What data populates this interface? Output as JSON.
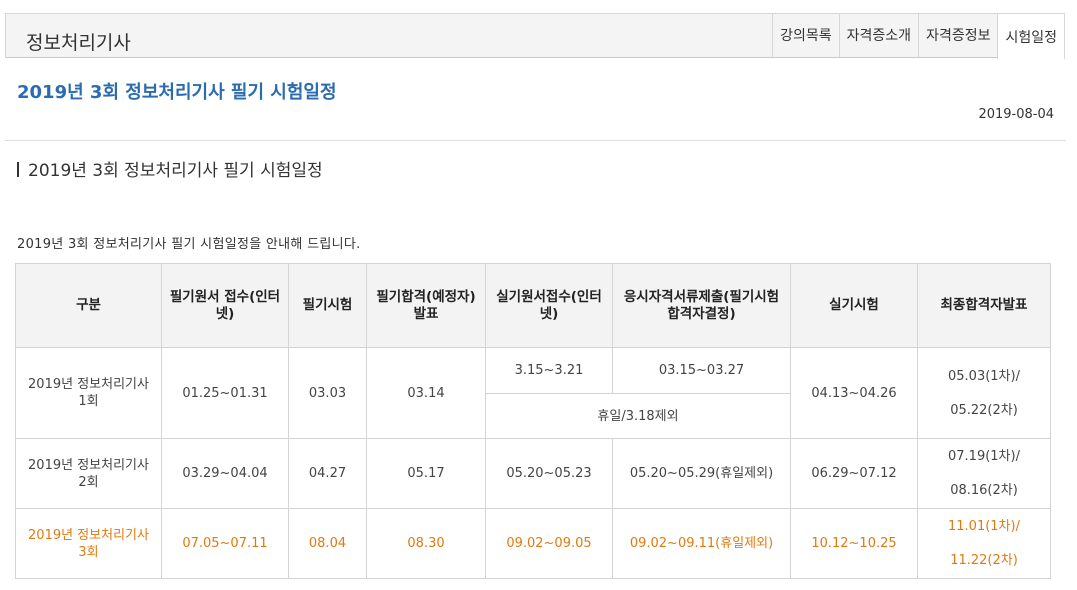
{
  "header": {
    "site_title": "정보처리기사",
    "tabs": [
      {
        "label": "강의목록",
        "active": false
      },
      {
        "label": "자격증소개",
        "active": false
      },
      {
        "label": "자격증정보",
        "active": false
      },
      {
        "label": "시험일정",
        "active": true
      }
    ]
  },
  "post": {
    "title": "2019년 3회 정보처리기사 필기 시험일정",
    "date": "2019-08-04",
    "section_heading": "2019년 3회 정보처리기사 필기 시험일정",
    "intro": "2019년 3회 정보처리기사 필기 시험일정을 안내해 드립니다."
  },
  "table": {
    "headers": [
      "구분",
      "필기원서 접수(인터넷)",
      "필기시험",
      "필기합격(예정자)발표",
      "실기원서접수(인터넷)",
      "응시자격서류제출(필기시험 합격자결정)",
      "실기시험",
      "최종합격자발표"
    ],
    "rows": [
      {
        "round": "2019년 정보처리기사 1회",
        "written_apply": "01.25~01.31",
        "written_exam": "03.03",
        "written_result": "03.14",
        "practical_apply": "3.15~3.21",
        "documents": "03.15~03.27",
        "holiday_note": "휴일/3.18제외",
        "practical_exam": "04.13~04.26",
        "final_result_1": "05.03(1차)/",
        "final_result_2": "05.22(2차)"
      },
      {
        "round": "2019년 정보처리기사 2회",
        "written_apply": "03.29~04.04",
        "written_exam": "04.27",
        "written_result": "05.17",
        "practical_apply": "05.20~05.23",
        "documents": "05.20~05.29(휴일제외)",
        "practical_exam": "06.29~07.12",
        "final_result_1": "07.19(1차)/",
        "final_result_2": "08.16(2차)"
      },
      {
        "round": "2019년 정보처리기사 3회",
        "written_apply": "07.05~07.11",
        "written_exam": "08.04",
        "written_result": "08.30",
        "practical_apply": "09.02~09.05",
        "documents": "09.02~09.11(휴일제외)",
        "practical_exam": "10.12~10.25",
        "final_result_1": "11.01(1차)/",
        "final_result_2": "11.22(2차)"
      }
    ]
  },
  "colors": {
    "title_blue": "#2b6cb0",
    "highlight_orange": "#e07a10"
  }
}
